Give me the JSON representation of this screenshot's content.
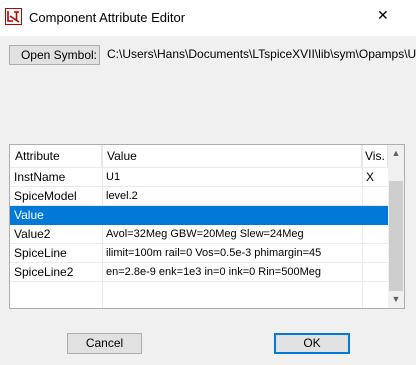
{
  "window": {
    "title": "Component Attribute Editor",
    "close_glyph": "✕",
    "app_icon": "ltspice-icon"
  },
  "symbol": {
    "open_label": "Open Symbol:",
    "path": "C:\\Users\\Hans\\Documents\\LTspiceXVII\\lib\\sym\\Opamps\\Univ"
  },
  "grid": {
    "headers": {
      "attribute": "Attribute",
      "value": "Value",
      "vis": "Vis."
    },
    "rows": [
      {
        "attribute": "InstName",
        "value": "U1",
        "vis": "X"
      },
      {
        "attribute": "SpiceModel",
        "value": "level.2",
        "vis": ""
      },
      {
        "attribute": "Value",
        "value": "",
        "vis": "",
        "selected": true
      },
      {
        "attribute": "Value2",
        "value": "Avol=32Meg GBW=20Meg Slew=24Meg",
        "vis": ""
      },
      {
        "attribute": "SpiceLine",
        "value": "ilimit=100m rail=0 Vos=0.5e-3 phimargin=45",
        "vis": ""
      },
      {
        "attribute": "SpiceLine2",
        "value": "en=2.8e-9 enk=1e3 in=0 ink=0 Rin=500Meg",
        "vis": ""
      }
    ]
  },
  "buttons": {
    "cancel": "Cancel",
    "ok": "OK"
  },
  "colors": {
    "selection": "#0078d7",
    "window_bg": "#f0f0f0",
    "button_bg": "#e1e1e1"
  }
}
